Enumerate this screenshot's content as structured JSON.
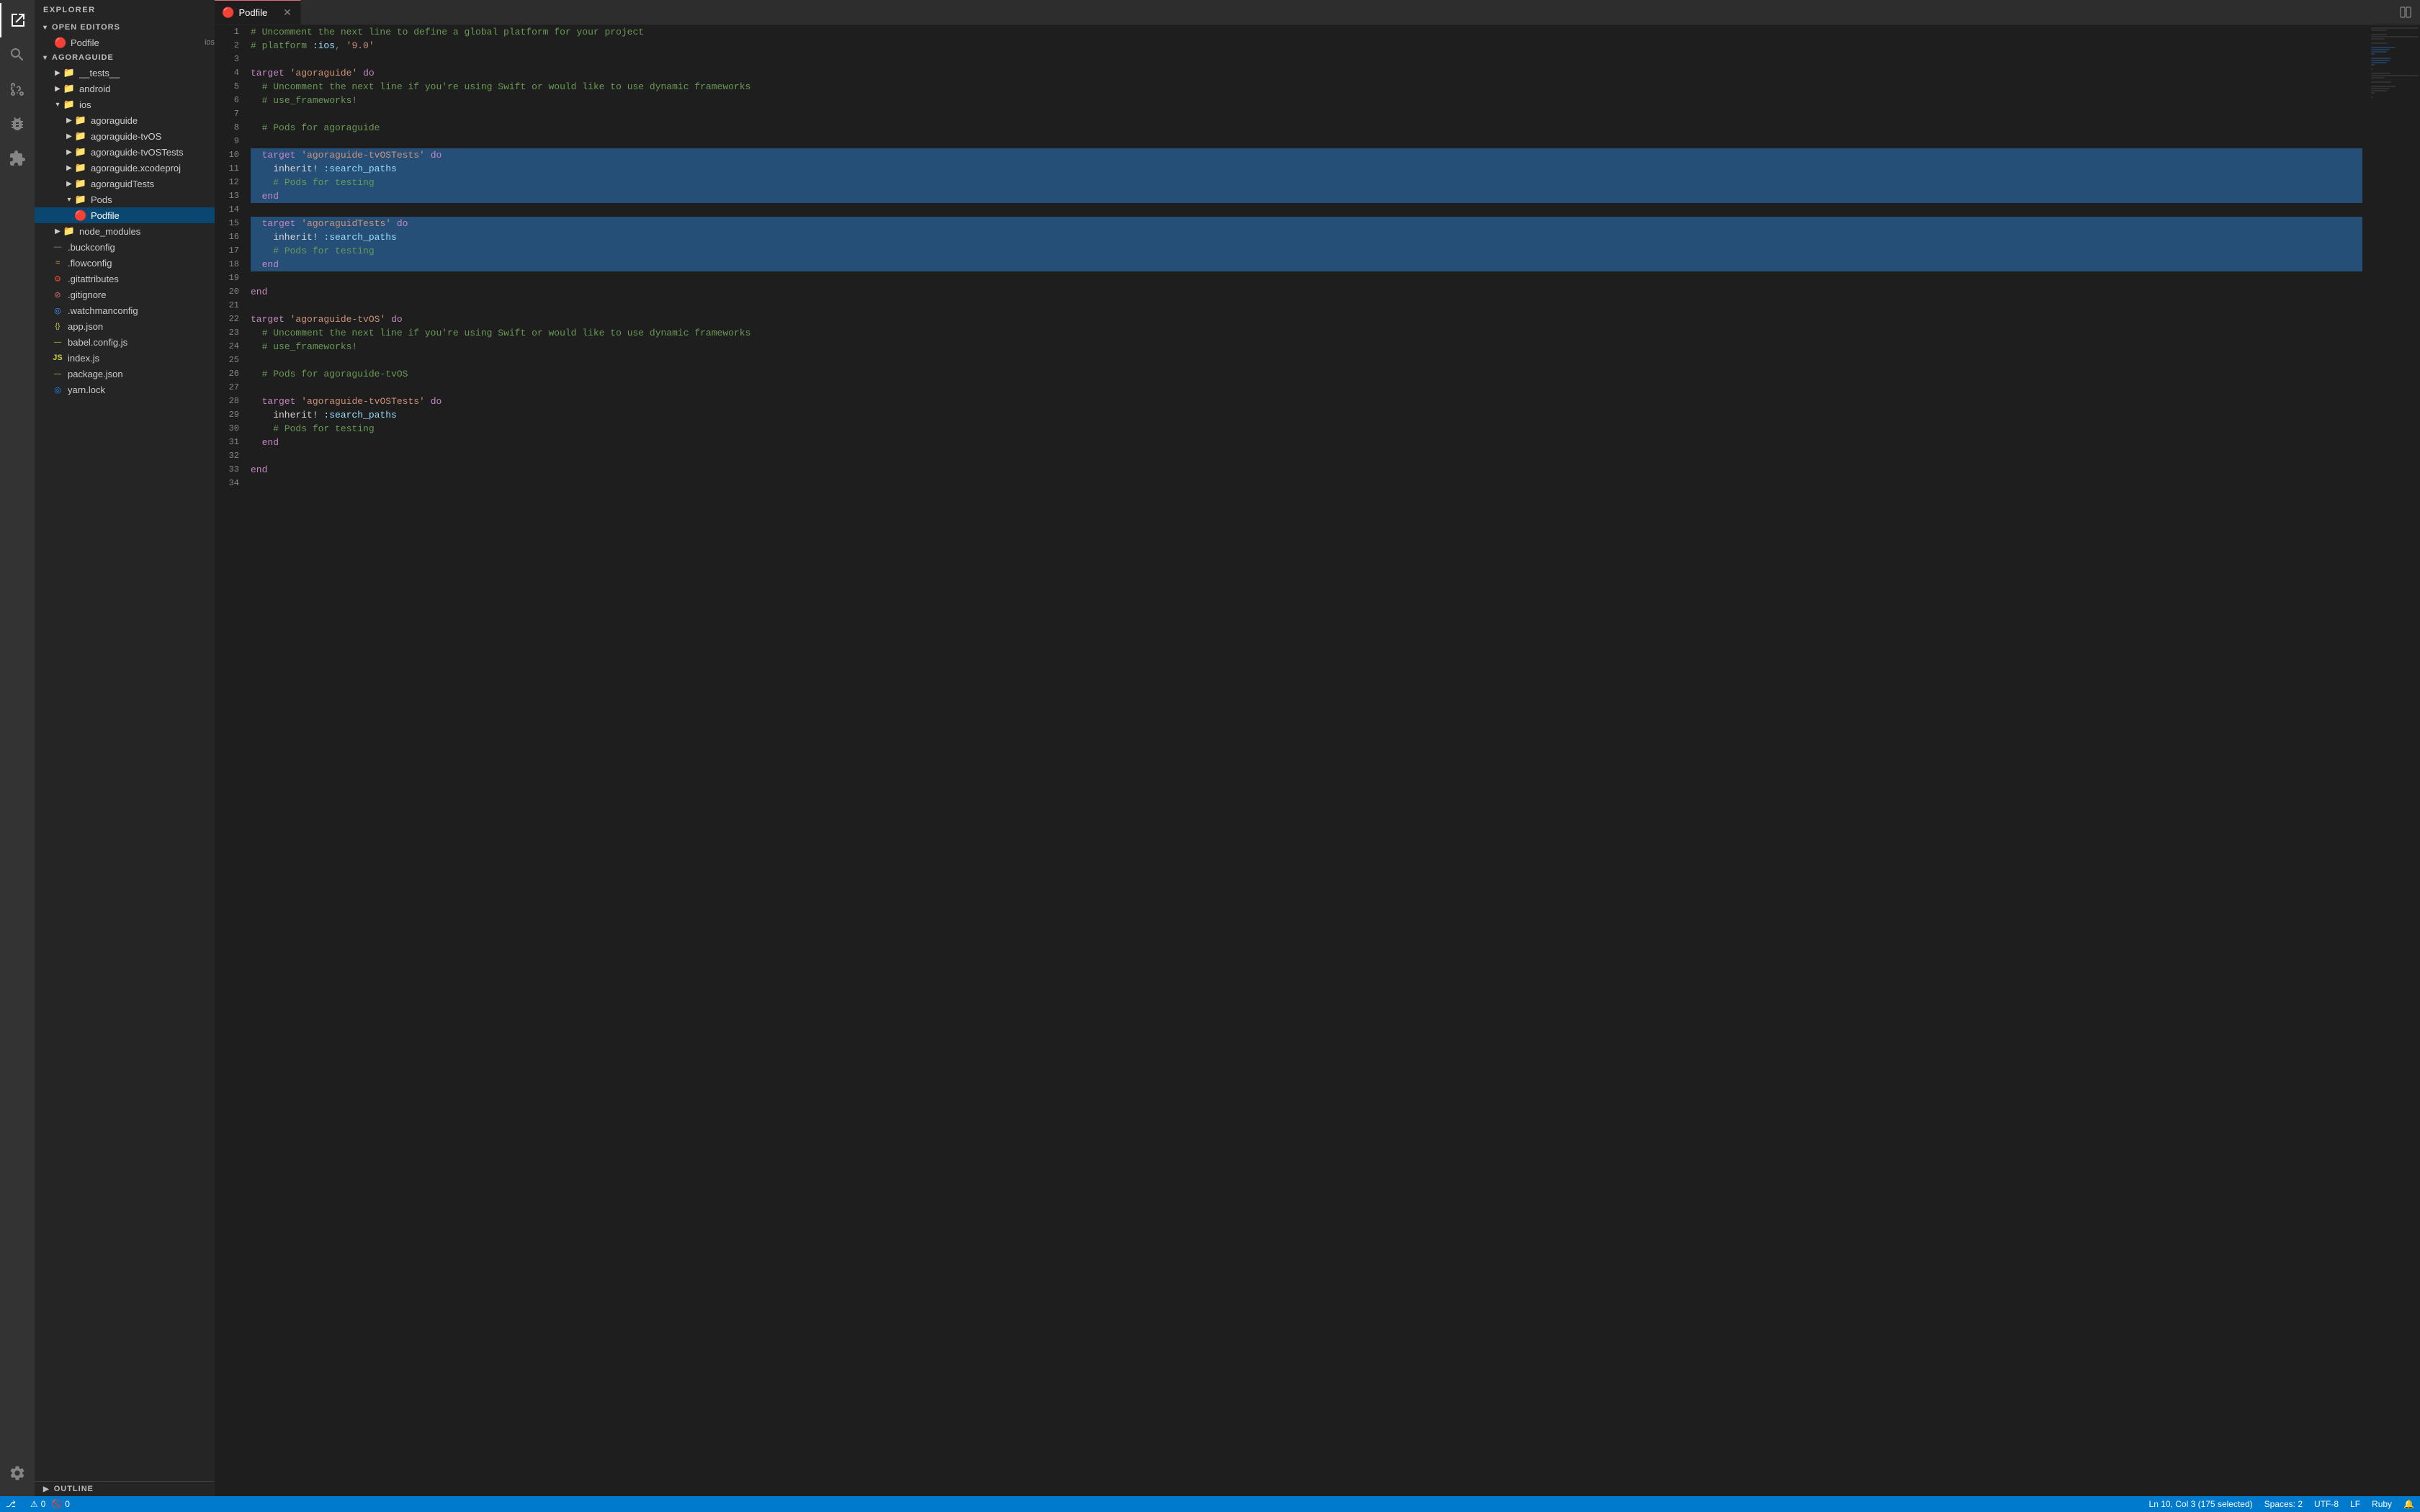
{
  "app": {
    "title": "EXPLORER"
  },
  "activity_bar": {
    "items": [
      {
        "name": "explorer",
        "icon": "files",
        "active": true
      },
      {
        "name": "search",
        "icon": "search",
        "active": false
      },
      {
        "name": "source-control",
        "icon": "git",
        "active": false
      },
      {
        "name": "debug",
        "icon": "debug",
        "active": false
      },
      {
        "name": "extensions",
        "icon": "extensions",
        "active": false
      }
    ],
    "bottom_items": [
      {
        "name": "settings",
        "icon": "gear"
      },
      {
        "name": "warnings",
        "label": "⚠ 0  🚫 0"
      }
    ]
  },
  "sidebar": {
    "title": "EXPLORER",
    "open_editors": {
      "label": "OPEN EDITORS",
      "items": [
        {
          "name": "Podfile",
          "badge": "ios",
          "icon": "podfile",
          "active": true
        }
      ]
    },
    "project": {
      "label": "AGORAGUIDE",
      "items": [
        {
          "name": "__tests__",
          "type": "folder",
          "depth": 0
        },
        {
          "name": "android",
          "type": "folder",
          "depth": 0
        },
        {
          "name": "ios",
          "type": "folder",
          "depth": 0,
          "expanded": true,
          "color": "ios"
        },
        {
          "name": "agoraguide",
          "type": "folder",
          "depth": 1
        },
        {
          "name": "agoraguide-tvOS",
          "type": "folder",
          "depth": 1
        },
        {
          "name": "agoraguide-tvOSTests",
          "type": "folder",
          "depth": 1
        },
        {
          "name": "agoraguide.xcodeproj",
          "type": "folder",
          "depth": 1
        },
        {
          "name": "agoraguidTests",
          "type": "folder",
          "depth": 1
        },
        {
          "name": "Pods",
          "type": "folder",
          "depth": 1
        },
        {
          "name": "Podfile",
          "type": "podfile",
          "depth": 2,
          "active": true
        },
        {
          "name": "node_modules",
          "type": "folder",
          "depth": 0
        },
        {
          "name": ".buckconfig",
          "type": "config",
          "depth": 0
        },
        {
          "name": ".flowconfig",
          "type": "flow",
          "depth": 0
        },
        {
          "name": ".gitattributes",
          "type": "git",
          "depth": 0
        },
        {
          "name": ".gitignore",
          "type": "git",
          "depth": 0
        },
        {
          "name": ".watchmanconfig",
          "type": "watchman",
          "depth": 0
        },
        {
          "name": "app.json",
          "type": "json",
          "depth": 0
        },
        {
          "name": "babel.config.js",
          "type": "js",
          "depth": 0
        },
        {
          "name": "index.js",
          "type": "js",
          "depth": 0
        },
        {
          "name": "package.json",
          "type": "json",
          "depth": 0
        },
        {
          "name": "yarn.lock",
          "type": "yarn",
          "depth": 0
        }
      ]
    }
  },
  "tab": {
    "label": "Podfile",
    "icon": "podfile",
    "dirty": false
  },
  "editor": {
    "filename": "Podfile",
    "lines": [
      {
        "num": 1,
        "text": "# Uncomment the next line to define a global platform for your project",
        "highlight": false
      },
      {
        "num": 2,
        "text": "# platform :ios, '9.0'",
        "highlight": false
      },
      {
        "num": 3,
        "text": "",
        "highlight": false
      },
      {
        "num": 4,
        "text": "target 'agoraguide' do",
        "highlight": false
      },
      {
        "num": 5,
        "text": "  # Uncomment the next line if you're using Swift or would like to use dynamic frameworks",
        "highlight": false
      },
      {
        "num": 6,
        "text": "  # use_frameworks!",
        "highlight": false
      },
      {
        "num": 7,
        "text": "",
        "highlight": false
      },
      {
        "num": 8,
        "text": "  # Pods for agoraguide",
        "highlight": false
      },
      {
        "num": 9,
        "text": "",
        "highlight": false
      },
      {
        "num": 10,
        "text": "  target 'agoraguide-tvOSTests' do",
        "highlight": true
      },
      {
        "num": 11,
        "text": "    inherit! :search_paths",
        "highlight": true
      },
      {
        "num": 12,
        "text": "    # Pods for testing",
        "highlight": true
      },
      {
        "num": 13,
        "text": "  end",
        "highlight": true
      },
      {
        "num": 14,
        "text": "",
        "highlight": false
      },
      {
        "num": 15,
        "text": "  target 'agoraguidTests' do",
        "highlight": true
      },
      {
        "num": 16,
        "text": "    inherit! :search_paths",
        "highlight": true
      },
      {
        "num": 17,
        "text": "    # Pods for testing",
        "highlight": true
      },
      {
        "num": 18,
        "text": "  end",
        "highlight": true
      },
      {
        "num": 19,
        "text": "",
        "highlight": false
      },
      {
        "num": 20,
        "text": "end",
        "highlight": false
      },
      {
        "num": 21,
        "text": "",
        "highlight": false
      },
      {
        "num": 22,
        "text": "target 'agoraguide-tvOS' do",
        "highlight": false
      },
      {
        "num": 23,
        "text": "  # Uncomment the next line if you're using Swift or would like to use dynamic frameworks",
        "highlight": false
      },
      {
        "num": 24,
        "text": "  # use_frameworks!",
        "highlight": false
      },
      {
        "num": 25,
        "text": "",
        "highlight": false
      },
      {
        "num": 26,
        "text": "  # Pods for agoraguide-tvOS",
        "highlight": false
      },
      {
        "num": 27,
        "text": "",
        "highlight": false
      },
      {
        "num": 28,
        "text": "  target 'agoraguide-tvOSTests' do",
        "highlight": false
      },
      {
        "num": 29,
        "text": "    inherit! :search_paths",
        "highlight": false
      },
      {
        "num": 30,
        "text": "    # Pods for testing",
        "highlight": false
      },
      {
        "num": 31,
        "text": "  end",
        "highlight": false
      },
      {
        "num": 32,
        "text": "",
        "highlight": false
      },
      {
        "num": 33,
        "text": "end",
        "highlight": false
      },
      {
        "num": 34,
        "text": "",
        "highlight": false
      }
    ]
  },
  "status_bar": {
    "left": [
      {
        "icon": "git-branch",
        "label": ""
      }
    ],
    "right": [
      {
        "label": "Ln 10, Col 3 (175 selected)"
      },
      {
        "label": "Spaces: 2"
      },
      {
        "label": "UTF-8"
      },
      {
        "label": "LF"
      },
      {
        "label": "Ruby"
      },
      {
        "icon": "bell",
        "label": ""
      },
      {
        "icon": "warning",
        "label": "⚠ 0  🚫 0"
      }
    ],
    "line_col": "Ln 10, Col 3 (175 selected)",
    "spaces": "Spaces: 2",
    "encoding": "UTF-8",
    "line_ending": "LF",
    "language": "Ruby"
  },
  "outline": {
    "label": "OUTLINE"
  }
}
